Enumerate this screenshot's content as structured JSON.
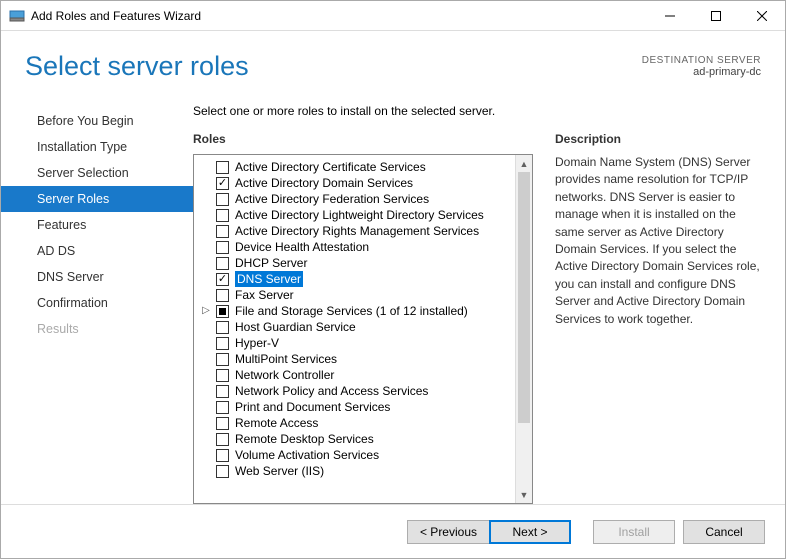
{
  "titlebar": {
    "text": "Add Roles and Features Wizard"
  },
  "header": {
    "title": "Select server roles",
    "destination_label": "DESTINATION SERVER",
    "destination_name": "ad-primary-dc"
  },
  "nav": {
    "items": [
      {
        "label": "Before You Begin",
        "state": "normal"
      },
      {
        "label": "Installation Type",
        "state": "normal"
      },
      {
        "label": "Server Selection",
        "state": "normal"
      },
      {
        "label": "Server Roles",
        "state": "selected"
      },
      {
        "label": "Features",
        "state": "normal"
      },
      {
        "label": "AD DS",
        "state": "normal"
      },
      {
        "label": "DNS Server",
        "state": "normal"
      },
      {
        "label": "Confirmation",
        "state": "normal"
      },
      {
        "label": "Results",
        "state": "disabled"
      }
    ]
  },
  "main": {
    "instruction": "Select one or more roles to install on the selected server.",
    "roles_header": "Roles",
    "roles": [
      {
        "label": "Active Directory Certificate Services",
        "checked": false
      },
      {
        "label": "Active Directory Domain Services",
        "checked": true
      },
      {
        "label": "Active Directory Federation Services",
        "checked": false
      },
      {
        "label": "Active Directory Lightweight Directory Services",
        "checked": false
      },
      {
        "label": "Active Directory Rights Management Services",
        "checked": false
      },
      {
        "label": "Device Health Attestation",
        "checked": false
      },
      {
        "label": "DHCP Server",
        "checked": false
      },
      {
        "label": "DNS Server",
        "checked": true,
        "selected": true
      },
      {
        "label": "Fax Server",
        "checked": false
      },
      {
        "label": "File and Storage Services (1 of 12 installed)",
        "indeterminate": true,
        "expandable": true
      },
      {
        "label": "Host Guardian Service",
        "checked": false
      },
      {
        "label": "Hyper-V",
        "checked": false
      },
      {
        "label": "MultiPoint Services",
        "checked": false
      },
      {
        "label": "Network Controller",
        "checked": false
      },
      {
        "label": "Network Policy and Access Services",
        "checked": false
      },
      {
        "label": "Print and Document Services",
        "checked": false
      },
      {
        "label": "Remote Access",
        "checked": false
      },
      {
        "label": "Remote Desktop Services",
        "checked": false
      },
      {
        "label": "Volume Activation Services",
        "checked": false
      },
      {
        "label": "Web Server (IIS)",
        "checked": false
      }
    ],
    "description_header": "Description",
    "description": "Domain Name System (DNS) Server provides name resolution for TCP/IP networks. DNS Server is easier to manage when it is installed on the same server as Active Directory Domain Services. If you select the Active Directory Domain Services role, you can install and configure DNS Server and Active Directory Domain Services to work together."
  },
  "footer": {
    "previous": "< Previous",
    "next": "Next >",
    "install": "Install",
    "cancel": "Cancel"
  }
}
